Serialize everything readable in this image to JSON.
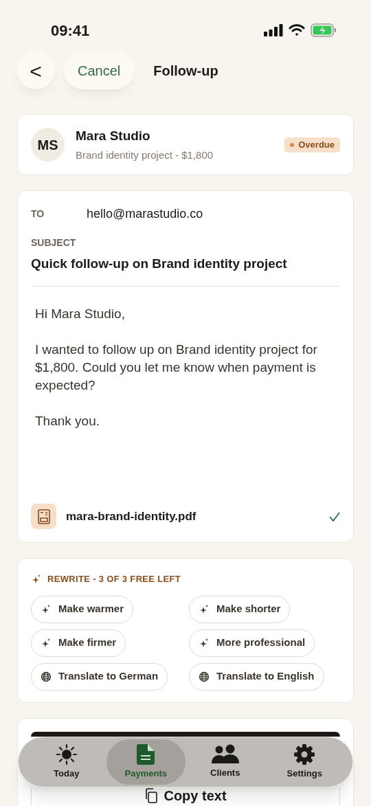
{
  "status_bar": {
    "time": "09:41"
  },
  "header": {
    "back": "<",
    "cancel": "Cancel",
    "title": "Follow-up"
  },
  "client": {
    "initials": "MS",
    "name": "Mara Studio",
    "detail": "Brand identity project - $1,800",
    "status": {
      "label": "Overdue",
      "color": "#d98a4e"
    }
  },
  "email": {
    "to_label": "TO",
    "to": "hello@marastudio.co",
    "subject_label": "SUBJECT",
    "subject": "Quick follow-up on Brand identity project",
    "body": [
      "Hi Mara Studio,",
      "I wanted to follow up on Brand identity project for $1,800. Could you let me know when payment is expected?",
      "Thank you."
    ],
    "attachment": {
      "name": "mara-brand-identity.pdf",
      "attached": true
    }
  },
  "rewrite": {
    "title": "REWRITE - 3 OF 3 FREE LEFT",
    "options": [
      {
        "label": "Make warmer",
        "kind": "tone"
      },
      {
        "label": "Make shorter",
        "kind": "tone"
      },
      {
        "label": "Make firmer",
        "kind": "tone"
      },
      {
        "label": "More professional",
        "kind": "tone"
      },
      {
        "label": "Translate to German",
        "kind": "translate"
      },
      {
        "label": "Translate to English",
        "kind": "translate"
      }
    ]
  },
  "actions": [
    {
      "kind": "primary"
    },
    {
      "label": "Copy text",
      "kind": "secondary"
    }
  ],
  "tab_bar": [
    {
      "label": "Today",
      "selected": false
    },
    {
      "label": "Payments",
      "selected": true
    },
    {
      "label": "Clients",
      "selected": false
    },
    {
      "label": "Settings",
      "selected": false
    }
  ]
}
